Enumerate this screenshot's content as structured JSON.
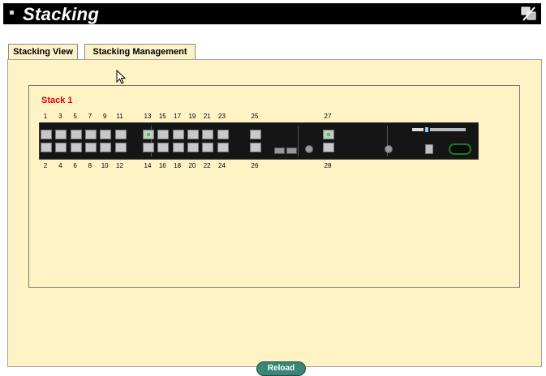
{
  "header": {
    "title": "Stacking",
    "icon": "stacking-tools-icon"
  },
  "tabs": [
    {
      "label": "Stacking View",
      "active": false
    },
    {
      "label": "Stacking Management",
      "active": true
    }
  ],
  "stack": {
    "label": "Stack 1",
    "top_ports": [
      "1",
      "3",
      "5",
      "7",
      "9",
      "11",
      "13",
      "15",
      "17",
      "19",
      "21",
      "23",
      "25",
      "27"
    ],
    "bottom_ports": [
      "2",
      "4",
      "6",
      "8",
      "10",
      "12",
      "14",
      "16",
      "18",
      "20",
      "22",
      "24",
      "26",
      "28"
    ],
    "link_active_ports": [
      "13",
      "27"
    ]
  },
  "colors": {
    "stack_label": "#e00000",
    "panel_bg": "#fff3c6",
    "reload_button": "#3a8576"
  },
  "actions": {
    "reload_label": "Reload"
  }
}
